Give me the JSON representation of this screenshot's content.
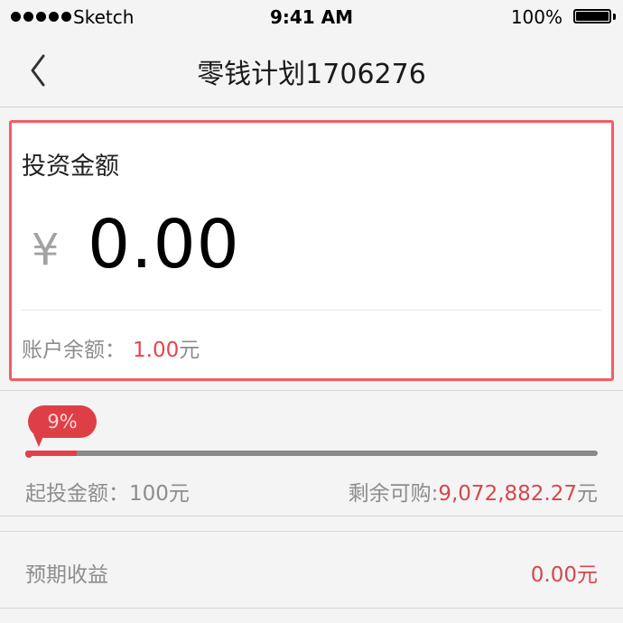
{
  "status_bar": {
    "carrier": "Sketch",
    "time": "9:41 AM",
    "battery": "100%"
  },
  "nav": {
    "title": "零钱计划1706276",
    "back_icon": "chevron-left-icon"
  },
  "invest_card": {
    "label": "投资金额",
    "currency_symbol": "¥",
    "amount": "0.00",
    "balance_label": "账户余额：",
    "balance_value": "1.00",
    "balance_unit": "元",
    "highlight_color": "#f45c62"
  },
  "progress": {
    "percent_label": "9%",
    "percent": 0.09,
    "min_label": "起投金额：100元",
    "remaining_label": "剩余可购:",
    "remaining_value": "9,072,882.27",
    "remaining_unit": "元"
  },
  "expected_yield": {
    "label": "预期收益",
    "value": "0.00元"
  },
  "colors": {
    "accent_red": "#e24049",
    "text_red": "#d4484e",
    "muted_text": "#8d8d8d"
  }
}
